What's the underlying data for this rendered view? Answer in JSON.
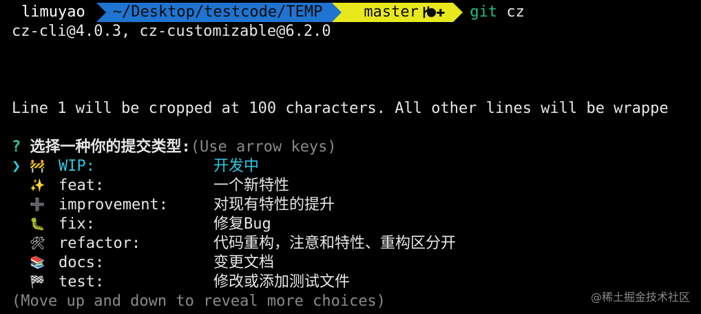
{
  "prompt": {
    "user": "limuyao",
    "directory": "~/Desktop/testcode/TEMP",
    "branch_icon": "git-branch-icon",
    "branch": "master",
    "status_symbol": "●✚",
    "command": "git",
    "command_arg": "cz",
    "colors": {
      "directory_bg": "#1f74d1",
      "git_bg": "#e9e81d",
      "command": "#20c080"
    }
  },
  "versions": "cz-cli@4.0.3, cz-customizable@6.2.0",
  "crop_notice": "Line 1 will be cropped at 100 characters. All other lines will be wrappe",
  "question": {
    "mark": "?",
    "text": "选择一种你的提交类型:",
    "hint": "(Use arrow keys)"
  },
  "pointer": "❯",
  "choices": [
    {
      "emoji": "🚧",
      "icon": "construction-icon",
      "name": "WIP:",
      "desc": "开发中",
      "selected": true
    },
    {
      "emoji": "✨",
      "icon": "sparkles-icon",
      "name": "feat:",
      "desc": "一个新特性",
      "selected": false
    },
    {
      "emoji": "➕",
      "icon": "plus-icon",
      "name": "improvement:",
      "desc": "对现有特性的提升",
      "selected": false
    },
    {
      "emoji": "🐛",
      "icon": "bug-icon",
      "name": "fix:",
      "desc": "修复Bug",
      "selected": false
    },
    {
      "emoji": "🛠",
      "icon": "tools-icon",
      "name": "refactor:",
      "desc": "代码重构，注意和特性、重构区分开",
      "selected": false
    },
    {
      "emoji": "📚",
      "icon": "books-icon",
      "name": "docs:",
      "desc": "变更文档",
      "selected": false
    },
    {
      "emoji": "🏁",
      "icon": "checkered-flag-icon",
      "name": "test:",
      "desc": "修改或添加测试文件",
      "selected": false
    }
  ],
  "footer_hint": "(Move up and down to reveal more choices)",
  "watermark": "@稀土掘金技术社区"
}
